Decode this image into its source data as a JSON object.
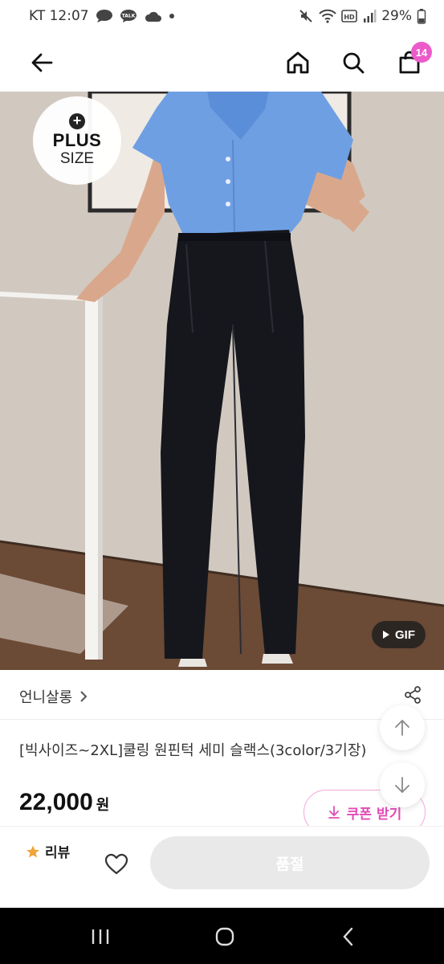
{
  "status_bar": {
    "carrier_time": "KT 12:07",
    "battery": "29%",
    "hd_label": "HD",
    "talk_label": "TALK",
    "icons": [
      "chat-bubble-icon",
      "kakaotalk-icon",
      "cloud-icon",
      "dot-icon",
      "mute-icon",
      "wifi-icon",
      "hd-icon",
      "signal-icon",
      "battery-icon"
    ]
  },
  "header": {
    "cart_count": "14",
    "icons": [
      "back-arrow-icon",
      "home-icon",
      "search-icon",
      "cart-icon"
    ],
    "badge_color": "#ec5bc9"
  },
  "product_image": {
    "badge": {
      "plus": "PLUS",
      "size": "SIZE"
    },
    "gif_label": "GIF"
  },
  "store": {
    "name": "언니살롱",
    "icons": [
      "chevron-right-icon",
      "share-icon"
    ]
  },
  "product": {
    "title": "[빅사이즈~2XL]쿨링 원핀턱 세미 슬랙스(3color/3기장)",
    "price": "22,000",
    "price_unit": "원"
  },
  "coupon": {
    "label": "쿠폰 받기",
    "color": "#e24cb5"
  },
  "floating": {
    "icons": [
      "scroll-up-icon",
      "scroll-down-icon"
    ]
  },
  "actions": {
    "review_label": "리뷰",
    "soldout_label": "품절",
    "icons": [
      "star-icon",
      "heart-icon"
    ],
    "star_color": "#f0a43a"
  },
  "nav": {
    "icons": [
      "recent-apps-icon",
      "home-circle-icon",
      "back-chevron-icon"
    ]
  }
}
